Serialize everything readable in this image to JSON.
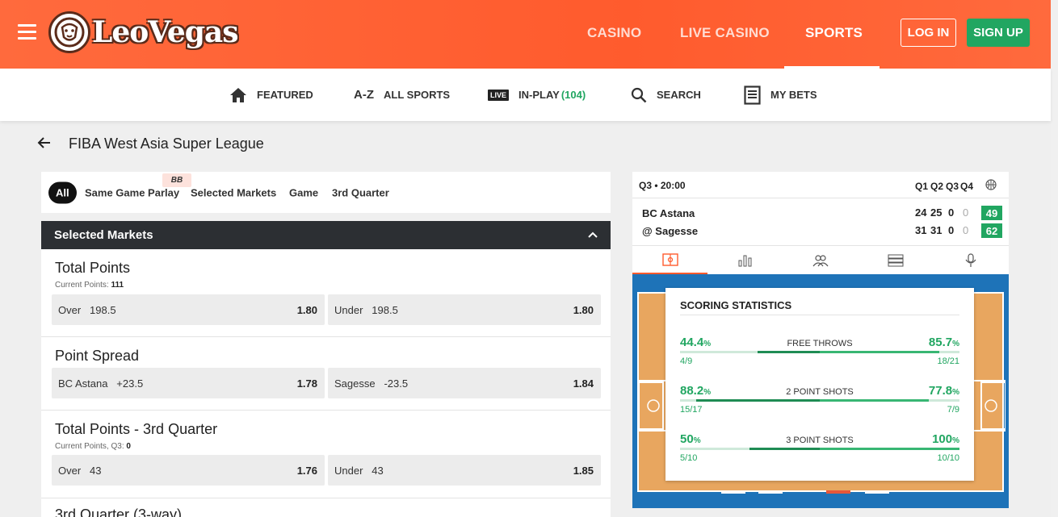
{
  "header": {
    "logo_text": "LeoVegas",
    "nav": [
      "CASINO",
      "LIVE CASINO",
      "SPORTS"
    ],
    "login": "LOG IN",
    "signup": "SIGN UP"
  },
  "subnav": {
    "featured": "FEATURED",
    "az_icon": "A-Z",
    "all_sports": "ALL SPORTS",
    "live_badge": "LIVE",
    "in_play": "IN-PLAY",
    "in_play_count": "(104)",
    "search": "SEARCH",
    "my_bets": "MY BETS"
  },
  "page": {
    "title": "FIBA West Asia Super League"
  },
  "tabs": {
    "all": "All",
    "same_game_parlay": "Same Game Parlay",
    "bb_badge": "BB",
    "selected_markets": "Selected Markets",
    "game": "Game",
    "third_quarter": "3rd Quarter"
  },
  "markets_header": "Selected Markets",
  "markets": [
    {
      "title": "Total Points",
      "sub_label": "Current Points:",
      "sub_value": "111",
      "odds": [
        {
          "label": "Over",
          "line": "198.5",
          "price": "1.80"
        },
        {
          "label": "Under",
          "line": "198.5",
          "price": "1.80"
        }
      ]
    },
    {
      "title": "Point Spread",
      "odds": [
        {
          "label": "BC Astana",
          "line": "+23.5",
          "price": "1.78"
        },
        {
          "label": "Sagesse",
          "line": "-23.5",
          "price": "1.84"
        }
      ]
    },
    {
      "title": "Total Points - 3rd Quarter",
      "sub_label": "Current Points, Q3:",
      "sub_value": "0",
      "odds": [
        {
          "label": "Over",
          "line": "43",
          "price": "1.76"
        },
        {
          "label": "Under",
          "line": "43",
          "price": "1.85"
        }
      ]
    },
    {
      "title": "3rd Quarter (3-way)"
    }
  ],
  "scoreboard": {
    "status": "Q3 • 20:00",
    "quarters": [
      "Q1",
      "Q2",
      "Q3",
      "Q4"
    ],
    "teams": [
      {
        "name": "BC Astana",
        "scores": [
          "24",
          "25",
          "0",
          "0"
        ],
        "total": "49"
      },
      {
        "name": "@ Sagesse",
        "scores": [
          "31",
          "31",
          "0",
          "0"
        ],
        "total": "62"
      }
    ]
  },
  "scoring_stats": {
    "title": "SCORING STATISTICS",
    "rows": [
      {
        "name": "FREE THROWS",
        "left_pct": "44.4",
        "left_frac": "4/9",
        "right_pct": "85.7",
        "right_frac": "18/21",
        "left_value": 0.444,
        "right_value": 0.857
      },
      {
        "name": "2 POINT SHOTS",
        "left_pct": "88.2",
        "left_frac": "15/17",
        "right_pct": "77.8",
        "right_frac": "7/9",
        "left_value": 0.882,
        "right_value": 0.778
      },
      {
        "name": "3 POINT SHOTS",
        "left_pct": "50",
        "left_frac": "5/10",
        "right_pct": "100",
        "right_frac": "10/10",
        "left_value": 0.5,
        "right_value": 1.0
      }
    ],
    "pct_sign": "%"
  },
  "colors": {
    "brand": "#ff5b2d",
    "green": "#21a661",
    "dark_header": "#2c2f33"
  }
}
